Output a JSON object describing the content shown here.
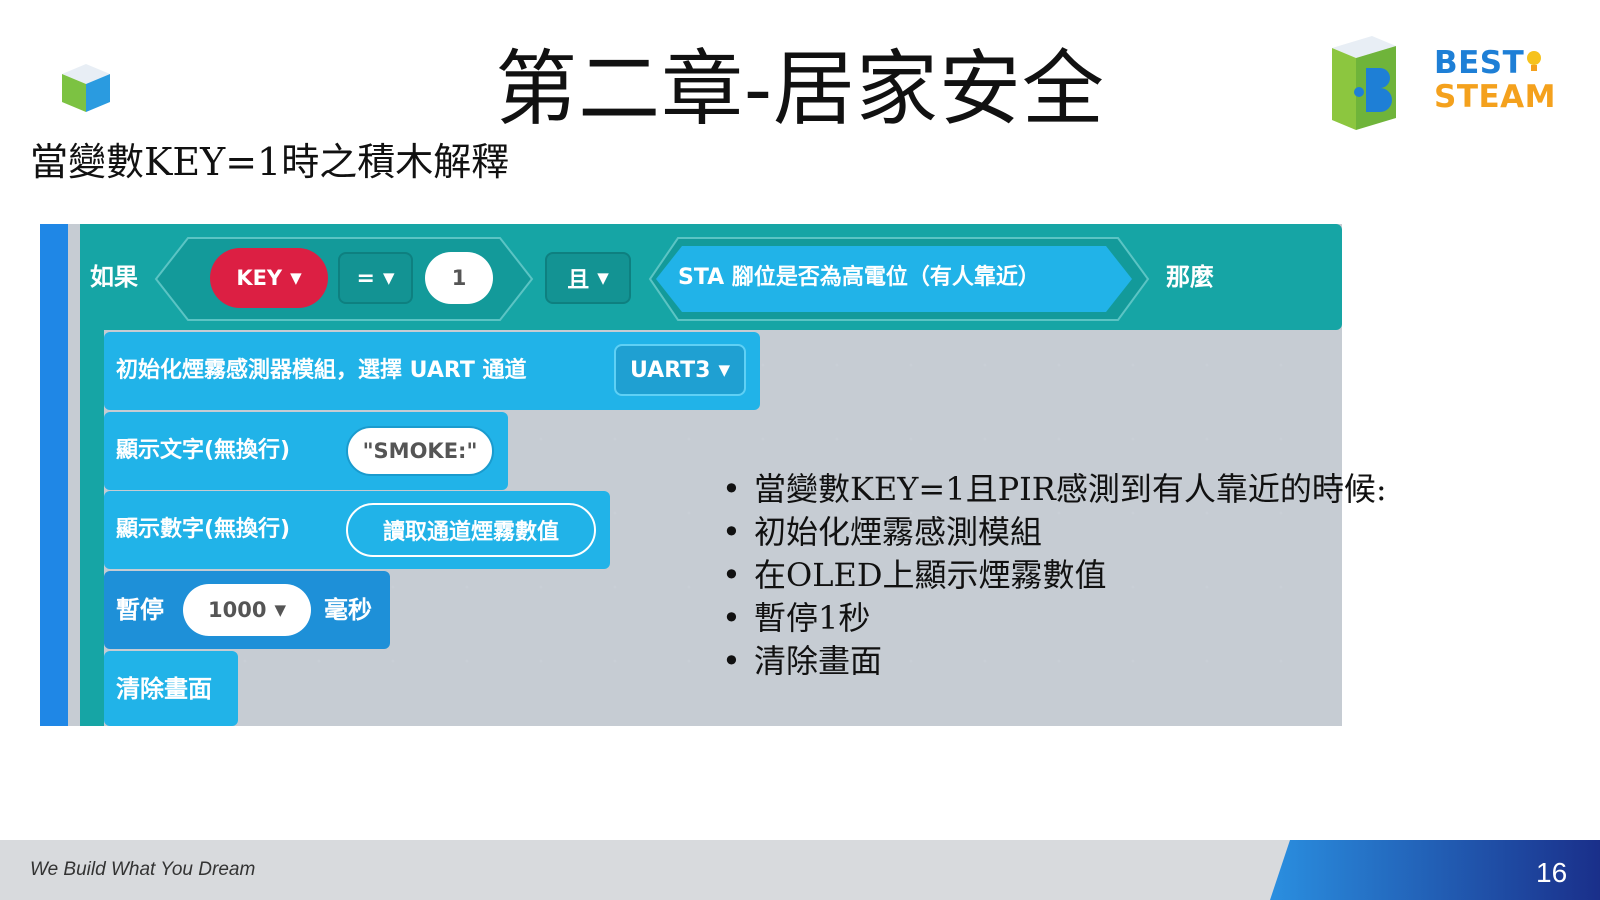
{
  "slide": {
    "title": "第二章-居家安全",
    "subtitle": "當變數KEY=1時之積木解釋",
    "logo": {
      "line1": "BEST",
      "line2": "STEAM"
    }
  },
  "blocks": {
    "if_label": "如果",
    "key_var": "KEY",
    "operator": "=",
    "number": "1",
    "and_label": "且",
    "condition": "STA 腳位是否為高電位（有人靠近）",
    "then_label": "那麼",
    "init_label": "初始化煙霧感測器模組，選擇 UART 通道",
    "uart_option": "UART3",
    "show_text_label": "顯示文字(無換行)",
    "show_text_value": "\"SMOKE:\"",
    "show_num_label": "顯示數字(無換行)",
    "show_num_value": "讀取通道煙霧數值",
    "pause_label": "暫停",
    "pause_value": "1000",
    "pause_unit": "毫秒",
    "clear_label": "清除畫面"
  },
  "notes": [
    "當變數KEY=1且PIR感測到有人靠近的時候:",
    "初始化煙霧感測模組",
    "在OLED上顯示煙霧數值",
    "暫停1秒",
    "清除畫面"
  ],
  "footer": {
    "tagline": "We Build What You Dream",
    "page_number": "16"
  },
  "colors": {
    "logic_teal": "#16a5a5",
    "key_red": "#dc1f43",
    "block_cyan": "#21b3e8",
    "logo_blue": "#1e7fd6",
    "logo_orange": "#f4a11d"
  }
}
